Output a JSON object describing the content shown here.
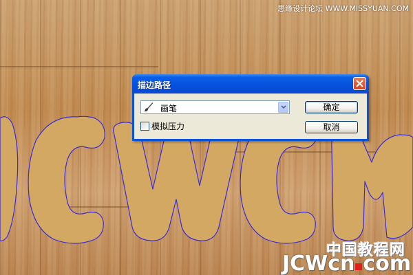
{
  "dialog": {
    "title": "描边路径",
    "tool_select": {
      "icon": "brush-icon",
      "value": "画笔"
    },
    "simulate_pressure": {
      "label": "模拟压力",
      "checked": false
    },
    "ok_label": "确定",
    "cancel_label": "取消"
  },
  "watermark": {
    "top_right": "思缘设计论坛  WWW.MISSYUAN.COM",
    "logo_cn": "中国教程网",
    "logo_en_part1": "JCWcn",
    "logo_en_part2": "com"
  },
  "canvas": {
    "background": "wood-texture",
    "letters_text": "JCWCN",
    "letter_fill": "#d2a863",
    "path_color": "#3a2bd6",
    "wood_color": "#c6925a"
  },
  "colors": {
    "title_bar": "#0550dc",
    "dialog_face": "#ece9d8",
    "close_button": "#d3441c",
    "logo_dot": "#e0201c"
  }
}
